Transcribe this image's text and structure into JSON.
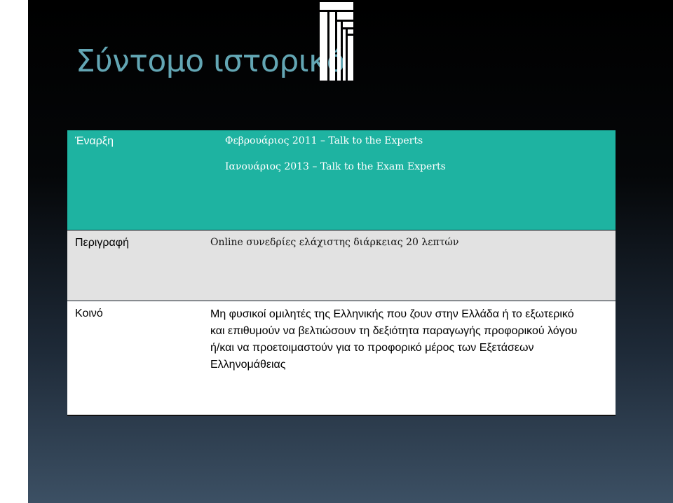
{
  "slide": {
    "title": "Σύντομο ιστορικό"
  },
  "table": {
    "start": {
      "label": "Έναρξη",
      "lines": [
        "Φεβρουάριος 2011 – Talk to the Experts",
        "Ιανουάριος 2013 – Talk to the Exam Experts"
      ]
    },
    "description": {
      "label": "Περιγραφή",
      "text": "Online συνεδρίες ελάχιστης διάρκειας 20 λεπτών"
    },
    "audience": {
      "label": "Κοινό",
      "text": "Μη φυσικοί ομιλητές της Ελληνικής που ζουν στην Ελλάδα ή το εξωτερικό και επιθυμούν να βελτιώσουν τη δεξιότητα παραγωγής προφορικού λόγου ή/και να προετοιμαστούν για το προφορικό μέρος των Εξετάσεων Ελληνομάθειας"
    }
  },
  "colors": {
    "title": "#63a6b4",
    "start_row": "#1eb3a1",
    "description_row": "#e2e2e2",
    "audience_row": "#ffffff",
    "decoration": "#ffffff"
  }
}
